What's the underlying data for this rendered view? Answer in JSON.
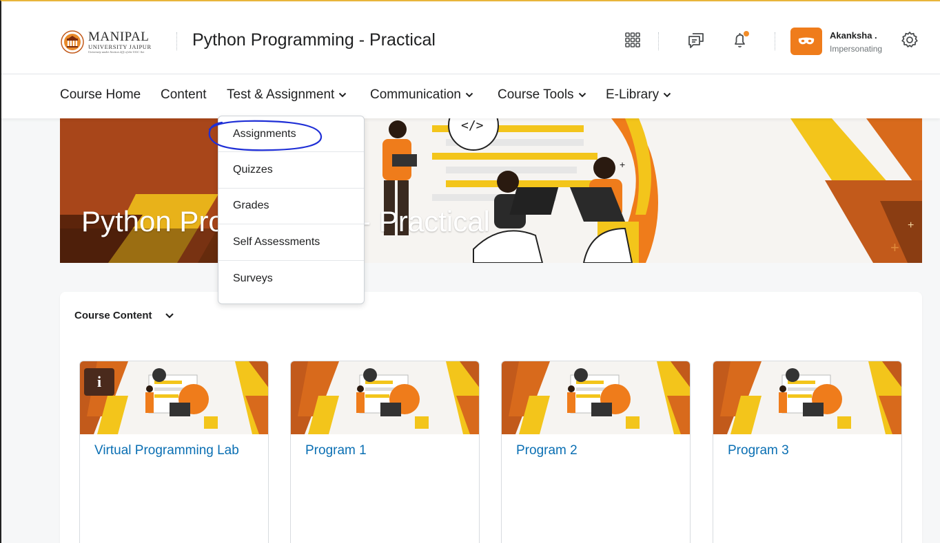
{
  "header": {
    "logo": {
      "name": "MANIPAL",
      "sub": "UNIVERSITY JAIPUR",
      "tagline": "University under Section 2(f) of the UGC Act"
    },
    "course_title": "Python Programming - Practical",
    "icons": [
      "apps-grid-icon",
      "chat-icon",
      "bell-icon",
      "settings-icon"
    ],
    "user": {
      "name": "Akanksha .",
      "status": "Impersonating"
    },
    "notification_color": "#f28c28"
  },
  "nav": {
    "items": [
      {
        "label": "Course Home"
      },
      {
        "label": "Content"
      },
      {
        "label": "Test & Assignment"
      },
      {
        "label": "Communication"
      },
      {
        "label": "Course Tools"
      },
      {
        "label": "E-Library"
      }
    ]
  },
  "dropdown": {
    "items": [
      "Assignments",
      "Quizzes",
      "Grades",
      "Self Assessments",
      "Surveys"
    ]
  },
  "banner": {
    "title": "Python Programming - Practical"
  },
  "content": {
    "heading": "Course Content",
    "cards": [
      {
        "title": "Virtual Programming Lab",
        "info_badge": "i"
      },
      {
        "title": "Program 1"
      },
      {
        "title": "Program 2"
      },
      {
        "title": "Program 3"
      }
    ]
  },
  "colors": {
    "accent_orange": "#ef7c1b",
    "banner_brown": "#8a3d12",
    "banner_yellow": "#f3c51b",
    "link_blue": "#0a6fb3",
    "annotation_blue": "#1f2fd6"
  }
}
